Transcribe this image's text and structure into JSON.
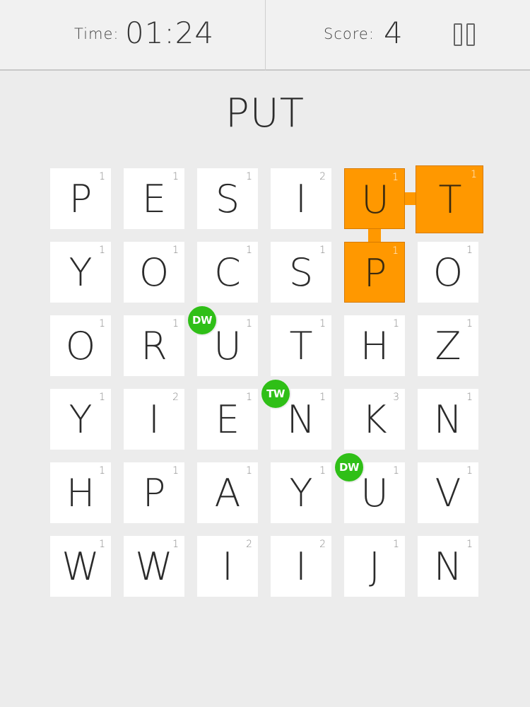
{
  "header": {
    "time_label": "Time:",
    "time_value": "01:24",
    "score_label": "Score:",
    "score_value": "4"
  },
  "current_word": "PUT",
  "grid": [
    [
      {
        "l": "P",
        "p": "1"
      },
      {
        "l": "E",
        "p": "1"
      },
      {
        "l": "S",
        "p": "1"
      },
      {
        "l": "I",
        "p": "2"
      },
      {
        "l": "U",
        "p": "1",
        "sel": true
      },
      {
        "l": "T",
        "p": "1",
        "sel": true
      }
    ],
    [
      {
        "l": "Y",
        "p": "1"
      },
      {
        "l": "O",
        "p": "1"
      },
      {
        "l": "C",
        "p": "1"
      },
      {
        "l": "S",
        "p": "1"
      },
      {
        "l": "P",
        "p": "1",
        "sel": true
      },
      {
        "l": "O",
        "p": "1"
      }
    ],
    [
      {
        "l": "O",
        "p": "1"
      },
      {
        "l": "R",
        "p": "1"
      },
      {
        "l": "U",
        "p": "1",
        "badge": "DW"
      },
      {
        "l": "T",
        "p": "1"
      },
      {
        "l": "H",
        "p": "1"
      },
      {
        "l": "Z",
        "p": "1"
      }
    ],
    [
      {
        "l": "Y",
        "p": "1"
      },
      {
        "l": "I",
        "p": "2"
      },
      {
        "l": "E",
        "p": "1"
      },
      {
        "l": "N",
        "p": "1",
        "badge": "TW"
      },
      {
        "l": "K",
        "p": "3"
      },
      {
        "l": "N",
        "p": "1"
      }
    ],
    [
      {
        "l": "H",
        "p": "1"
      },
      {
        "l": "P",
        "p": "1"
      },
      {
        "l": "A",
        "p": "1"
      },
      {
        "l": "Y",
        "p": "1"
      },
      {
        "l": "U",
        "p": "1",
        "badge": "DW"
      },
      {
        "l": "V",
        "p": "1"
      }
    ],
    [
      {
        "l": "W",
        "p": "1"
      },
      {
        "l": "W",
        "p": "1"
      },
      {
        "l": "I",
        "p": "2"
      },
      {
        "l": "I",
        "p": "2"
      },
      {
        "l": "J",
        "p": "1"
      },
      {
        "l": "N",
        "p": "1"
      }
    ]
  ],
  "colors": {
    "selected": "#ff9800",
    "badge": "#2fbf17",
    "tile": "#ffffff",
    "background": "#ececec"
  },
  "icons": {
    "pause": "pause-icon"
  }
}
